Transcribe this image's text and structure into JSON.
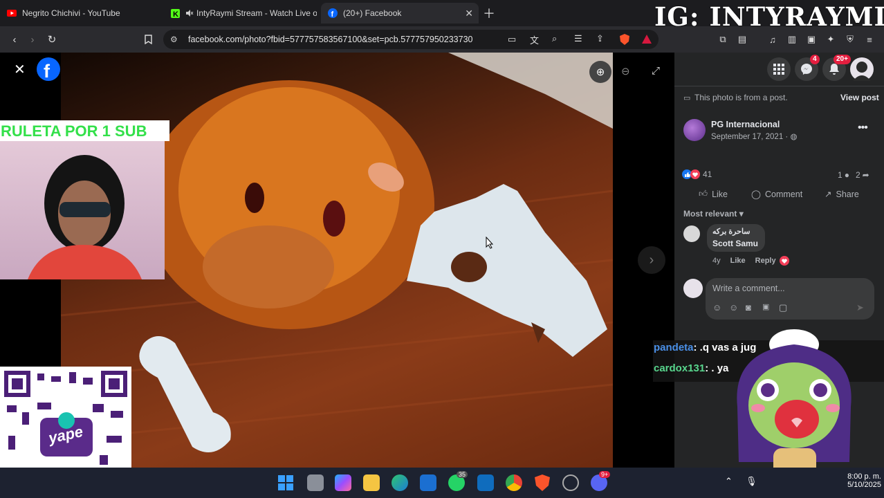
{
  "browser": {
    "tabs": [
      {
        "title": "Negrito Chichivi - YouTube",
        "icon": "youtube-icon",
        "active": false
      },
      {
        "title": "IntyRaymi Stream - Watch Live on",
        "icon": "kick-icon",
        "active": false
      },
      {
        "title": "(20+) Facebook",
        "icon": "facebook-icon",
        "active": true
      }
    ],
    "url": "facebook.com/photo?fbid=577757583567100&set=pcb.577757950233730"
  },
  "overlay": {
    "watermark": "IG: INTYRAYMI",
    "banner": "RULETA POR 1 SUB",
    "qr_logo_text": "yape",
    "chat": [
      {
        "user": "pandeta",
        "text": ": .q vas a jug",
        "color": "#4a8fe7"
      },
      {
        "user": "cardox131",
        "text": ": . ya",
        "color": "#58d68d"
      }
    ]
  },
  "facebook": {
    "notifications": {
      "messenger": "4",
      "alerts": "20+"
    },
    "post_notice": "This photo is from a post.",
    "view_post": "View post",
    "author": "PG Internacional",
    "date": "September 17, 2021 ·",
    "reaction_count": "41",
    "comment_count": "1",
    "share_count": "2",
    "actions": {
      "like": "Like",
      "comment": "Comment",
      "share": "Share"
    },
    "sort_label": "Most relevant",
    "comment": {
      "name_line1": "ساحرة بركه",
      "name_line2": "Scott Samu",
      "age": "4y",
      "like": "Like",
      "reply": "Reply"
    },
    "write_placeholder": "Write a comment..."
  },
  "taskbar": {
    "whatsapp_badge": "35",
    "discord_badge": "9+",
    "time": "8:00 p. m.",
    "date": "5/10/2025"
  },
  "colors": {
    "fb_blue": "#0866ff",
    "panel": "#242526",
    "taskbar": "#1d2230"
  }
}
